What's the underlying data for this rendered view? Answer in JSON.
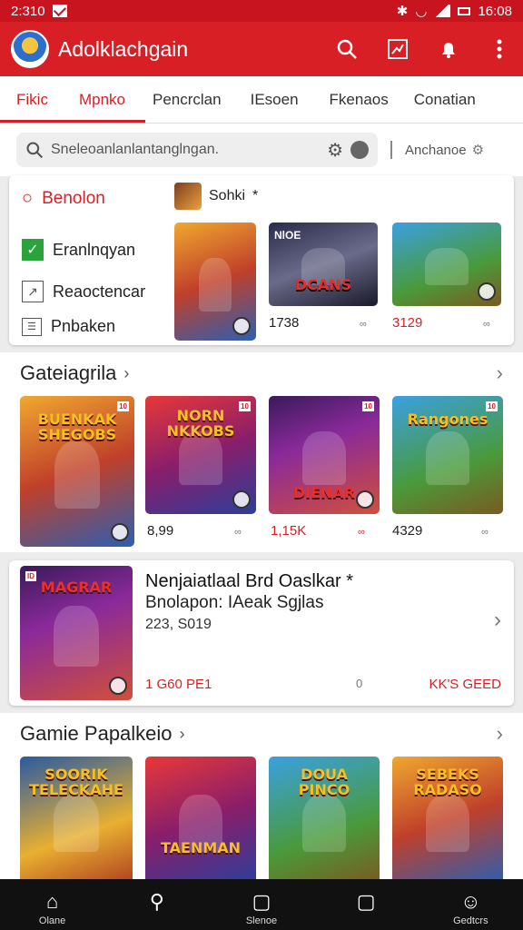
{
  "status": {
    "time_left": "2:310",
    "time_right": "16:08"
  },
  "app": {
    "title": "Adolklachgain"
  },
  "tabs": [
    "Fikic",
    "Mpnko",
    "Pencrclan",
    "IEsoen",
    "Fkenaos",
    "Conatian"
  ],
  "search": {
    "placeholder": "Sneleoanlanlantanglngan.",
    "anchor": "Anchanoe"
  },
  "filter": {
    "title": "Benolon",
    "sheet_label": "Sohki",
    "items": [
      "Eranlnqyan",
      "Reaoctencar",
      "Pnbaken"
    ]
  },
  "top_row": {
    "tiles": [
      {
        "title": ""
      },
      {
        "title": "DCANS",
        "tag": "NlOE"
      },
      {
        "title": ""
      }
    ],
    "prices": [
      "1738",
      "3129"
    ],
    "minis": [
      "∞",
      "∞"
    ]
  },
  "section1": {
    "title": "Gateiagrila",
    "tiles": [
      {
        "title": "BUENKAK\nSHEGOBS",
        "tag": "10"
      },
      {
        "title": "NORN\nNKKOBS",
        "tag": "10"
      },
      {
        "title": "DIENAR",
        "tag": "10"
      },
      {
        "title": "Rangones",
        "tag": "10"
      }
    ],
    "prices": [
      "8,99",
      "1,15K",
      "4329"
    ],
    "minis": [
      "∞",
      "∞",
      "∞"
    ]
  },
  "featured": {
    "tile_title": "MAGRAR",
    "line1": "Nenjaiatlaal Brd Oaslkar *",
    "line2": "Bnolapon: IAeak Sgjlas",
    "line3": "223, S019",
    "bottom_left": "1 G60 PE1",
    "bottom_mid": "0",
    "bottom_right": "KK'S GEED"
  },
  "section2": {
    "title": "Gamie Papalkeio",
    "tiles": [
      {
        "title": "SOORIK\nTELECKAHE"
      },
      {
        "title": "TAENMAN"
      },
      {
        "title": "DOUA\nPINCO"
      },
      {
        "title": "SEBEKS\nRADASO"
      }
    ]
  },
  "nav": [
    {
      "label": "Olane",
      "icon": "⌂"
    },
    {
      "label": "",
      "icon": "⚲"
    },
    {
      "label": "Slenoe",
      "icon": "▢"
    },
    {
      "label": "",
      "icon": "▢"
    },
    {
      "label": "Gedtcrs",
      "icon": "☺"
    }
  ]
}
